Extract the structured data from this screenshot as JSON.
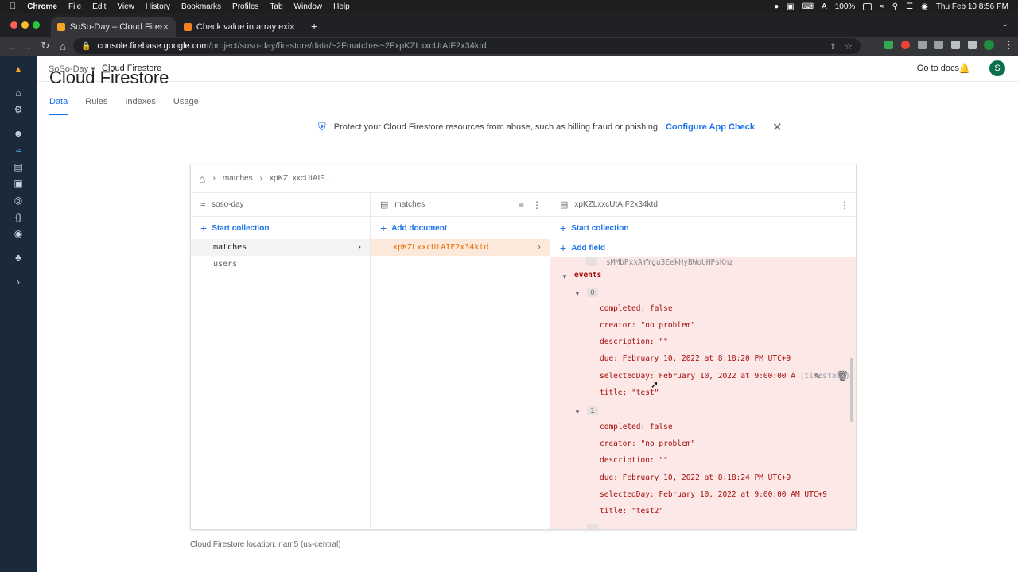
{
  "mac_menu": {
    "app": "Chrome",
    "items": [
      "File",
      "Edit",
      "View",
      "History",
      "Bookmarks",
      "Profiles",
      "Tab",
      "Window",
      "Help"
    ],
    "battery": "100%",
    "clock": "Thu Feb 10  8:56 PM"
  },
  "browser": {
    "tabs": [
      {
        "title": "SoSo-Day – Cloud Firestore – F",
        "active": true
      },
      {
        "title": "Check value in array exists Flu",
        "active": false
      }
    ],
    "url_host": "console.firebase.google.com",
    "url_path": "/project/soso-day/firestore/data/~2Fmatches~2FxpKZLxxcUtAIF2x34ktd"
  },
  "appbar": {
    "project": "SoSo-Day",
    "product": "Cloud Firestore",
    "go_to_docs": "Go to docs",
    "avatar_letter": "S"
  },
  "page": {
    "title": "Cloud Firestore",
    "tabs": [
      "Data",
      "Rules",
      "Indexes",
      "Usage"
    ],
    "active_tab": "Data"
  },
  "banner": {
    "text": "Protect your Cloud Firestore resources from abuse, such as billing fraud or phishing",
    "link": "Configure App Check"
  },
  "breadcrumb": [
    "matches",
    "xpKZLxxcUtAIF..."
  ],
  "columns": {
    "root": {
      "title": "soso-day",
      "action": "Start collection",
      "items": [
        "matches",
        "users"
      ],
      "selected": "matches"
    },
    "collection": {
      "title": "matches",
      "action": "Add document",
      "items": [
        "xpKZLxxcUtAIF2x34ktd"
      ]
    },
    "document": {
      "title": "xpKZLxxcUtAIF2x34ktd",
      "action": "Start collection",
      "add_field": "Add field",
      "partial_row": "sMMbPxxAYYgu3EekHyBWoUHPsKnz",
      "array_field": "events",
      "events": [
        {
          "index": "0",
          "fields": [
            {
              "key": "completed:",
              "value": "false"
            },
            {
              "key": "creator:",
              "value": "\"no problem\""
            },
            {
              "key": "description:",
              "value": "\"\""
            },
            {
              "key": "due:",
              "value": "February 10, 2022 at 8:18:20 PM UTC+9"
            },
            {
              "key": "selectedDay:",
              "value": "February 10, 2022 at 9:00:00 A",
              "type": "(timestamp)"
            },
            {
              "key": "title:",
              "value": "\"test\""
            }
          ]
        },
        {
          "index": "1",
          "fields": [
            {
              "key": "completed:",
              "value": "false"
            },
            {
              "key": "creator:",
              "value": "\"no problem\""
            },
            {
              "key": "description:",
              "value": "\"\""
            },
            {
              "key": "due:",
              "value": "February 10, 2022 at 8:18:24 PM UTC+9"
            },
            {
              "key": "selectedDay:",
              "value": "February 10, 2022 at 9:00:00 AM UTC+9"
            },
            {
              "key": "title:",
              "value": "\"test2\""
            }
          ]
        }
      ]
    }
  },
  "footer": {
    "location": "Cloud Firestore location: nam5 (us-central)"
  },
  "colors": {
    "accent": "#1a73e8",
    "highlight_bg": "#fde9dc",
    "field_bg": "#fce8e6",
    "field_text": "#a50e0e",
    "rail_bg": "#1a2a3a"
  }
}
